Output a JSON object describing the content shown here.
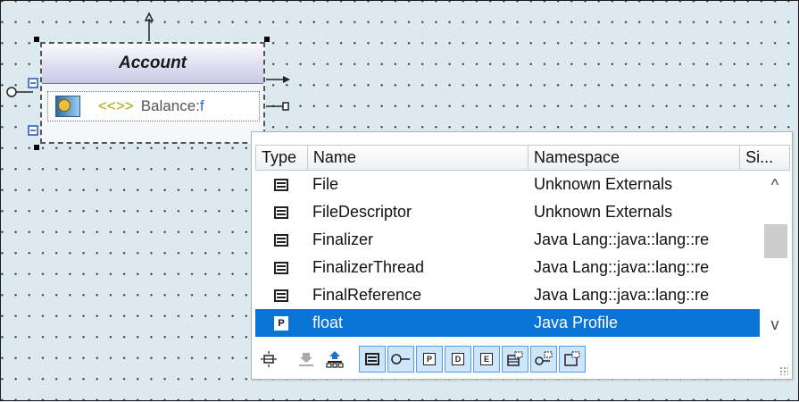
{
  "diagram": {
    "class_name": "Account",
    "attribute": {
      "stereotype": "<<>>",
      "text": "Balance:",
      "typed": "f"
    }
  },
  "popup": {
    "columns": [
      "Type",
      "Name",
      "Namespace",
      "Si..."
    ],
    "rows": [
      {
        "icon": "class-icon",
        "name": "File",
        "namespace": "Unknown Externals",
        "selected": false
      },
      {
        "icon": "class-icon",
        "name": "FileDescriptor",
        "namespace": "Unknown Externals",
        "selected": false
      },
      {
        "icon": "class-icon",
        "name": "Finalizer",
        "namespace": "Java Lang::java::lang::re",
        "selected": false
      },
      {
        "icon": "class-icon",
        "name": "FinalizerThread",
        "namespace": "Java Lang::java::lang::re",
        "selected": false
      },
      {
        "icon": "class-icon",
        "name": "FinalReference",
        "namespace": "Java Lang::java::lang::re",
        "selected": false
      },
      {
        "icon": "primitive-type-icon",
        "name": "float",
        "namespace": "Java Profile",
        "selected": true
      }
    ],
    "primitive_badge": "P",
    "toolbar": {
      "filter_buttons": [
        {
          "name": "class-filter-button",
          "glyph": "▤",
          "active": true
        },
        {
          "name": "interface-filter-button",
          "glyph": "○—",
          "active": true
        },
        {
          "name": "primitive-filter-button",
          "glyph": "P",
          "active": true
        },
        {
          "name": "datatype-filter-button",
          "glyph": "D",
          "active": true
        },
        {
          "name": "enumeration-filter-button",
          "glyph": "E",
          "active": true
        },
        {
          "name": "template-class-filter-button",
          "glyph": "▤",
          "active": true
        },
        {
          "name": "template-interface-filter-button",
          "glyph": "○—",
          "active": true
        },
        {
          "name": "template-type-filter-button",
          "glyph": "▢",
          "active": true
        }
      ]
    }
  },
  "colors": {
    "selection": "#0a74d6",
    "canvas": "#dce9ee",
    "filter_active": "#cfe5fb"
  }
}
